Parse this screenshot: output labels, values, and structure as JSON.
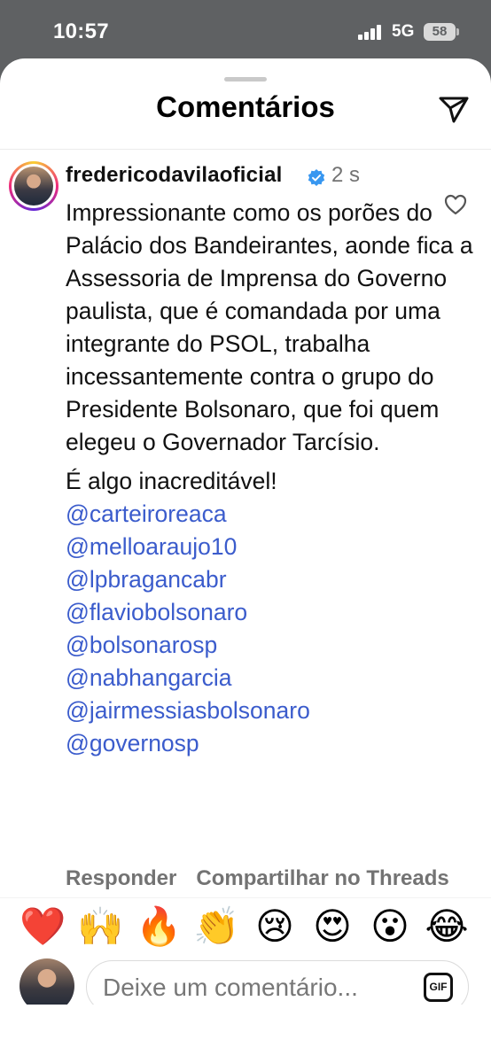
{
  "status_bar": {
    "time": "10:57",
    "network": "5G",
    "battery": "58"
  },
  "sheet": {
    "title": "Comentários"
  },
  "comment": {
    "username": "fredericodavilaoficial",
    "time_ago": "2 s",
    "text": "Impressionante como os porões do Palácio dos Bandeirantes, aonde fica a Assessoria de Imprensa do Governo paulista, que é comandada por uma integrante do PSOL, trabalha incessantemente contra o grupo do Presidente Bolsonaro, que foi quem elegeu o Governador Tarcísio.",
    "closing": "É algo inacreditável!",
    "mentions": [
      "@carteiroreaca",
      "@melloaraujo10",
      "@lpbragancabr",
      "@flaviobolsonaro",
      "@bolsonarosp",
      "@nabhangarcia",
      "@jairmessiasbolsonaro",
      "@governosp"
    ],
    "actions": {
      "reply": "Responder",
      "share": "Compartilhar no Threads"
    }
  },
  "emoji_bar": [
    "❤️",
    "🙌",
    "🔥",
    "👏",
    "😢",
    "😍",
    "😮",
    "😂"
  ],
  "composer": {
    "placeholder": "Deixe um comentário...",
    "gif_label": "GIF"
  },
  "colors": {
    "mention": "#3b5ccc",
    "verified": "#3897f0",
    "secondary_text": "#737373"
  }
}
